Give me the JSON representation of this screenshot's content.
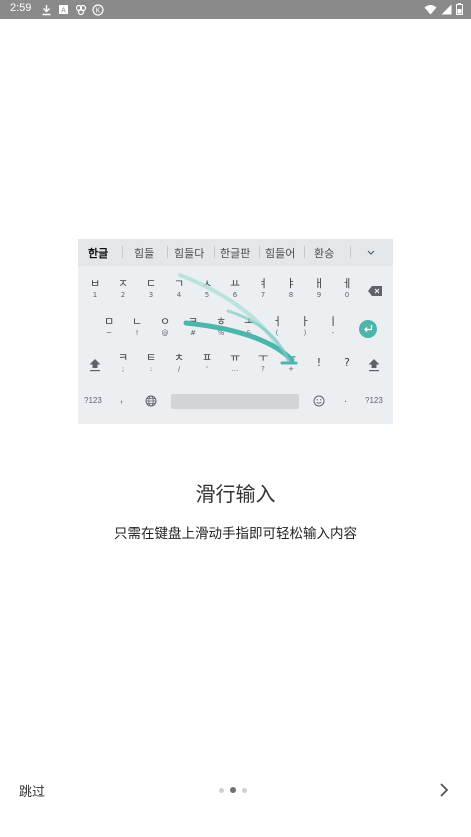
{
  "status_bar": {
    "time": "2:59",
    "left_icons": [
      "download-icon",
      "notification-a-icon",
      "app-icon",
      "k-circle-icon"
    ],
    "right_icons": [
      "wifi-icon",
      "signal-icon",
      "battery-icon"
    ]
  },
  "keyboard": {
    "suggestions": [
      "한글",
      "힘들",
      "힘들다",
      "한글판",
      "힘들어",
      "환승"
    ],
    "row1": [
      {
        "main": "ㅂ",
        "sub": "1"
      },
      {
        "main": "ㅈ",
        "sub": "2"
      },
      {
        "main": "ㄷ",
        "sub": "3"
      },
      {
        "main": "ㄱ",
        "sub": "4"
      },
      {
        "main": "ㅅ",
        "sub": "5"
      },
      {
        "main": "ㅛ",
        "sub": "6"
      },
      {
        "main": "ㅕ",
        "sub": "7"
      },
      {
        "main": "ㅑ",
        "sub": "8"
      },
      {
        "main": "ㅐ",
        "sub": "9"
      },
      {
        "main": "ㅔ",
        "sub": "0"
      }
    ],
    "row2": [
      {
        "main": "ㅁ",
        "sub": "~"
      },
      {
        "main": "ㄴ",
        "sub": "!"
      },
      {
        "main": "ㅇ",
        "sub": "@"
      },
      {
        "main": "ㄹ",
        "sub": "#"
      },
      {
        "main": "ㅎ",
        "sub": "%"
      },
      {
        "main": "ㅗ",
        "sub": "&"
      },
      {
        "main": "ㅓ",
        "sub": "("
      },
      {
        "main": "ㅏ",
        "sub": ")"
      },
      {
        "main": "ㅣ",
        "sub": "-"
      }
    ],
    "row3": [
      {
        "main": "ㅋ",
        "sub": ";"
      },
      {
        "main": "ㅌ",
        "sub": ":"
      },
      {
        "main": "ㅊ",
        "sub": "/"
      },
      {
        "main": "ㅍ",
        "sub": "'"
      },
      {
        "main": "ㅠ",
        "sub": "..."
      },
      {
        "main": "ㅜ",
        "sub": "?"
      },
      {
        "main": "ㅡ",
        "sub": "+"
      }
    ],
    "row3_punct": [
      "!",
      "?"
    ],
    "symbols_key": "?123",
    "comma_key": ",",
    "period_key": ".",
    "symbols_key_right": "?123",
    "swipe_color": "#4db6ac"
  },
  "title": "滑行输入",
  "subtitle": "只需在键盘上滑动手指即可轻松输入内容",
  "footer": {
    "skip_label": "跳过",
    "page_count": 3,
    "active_page": 2
  }
}
